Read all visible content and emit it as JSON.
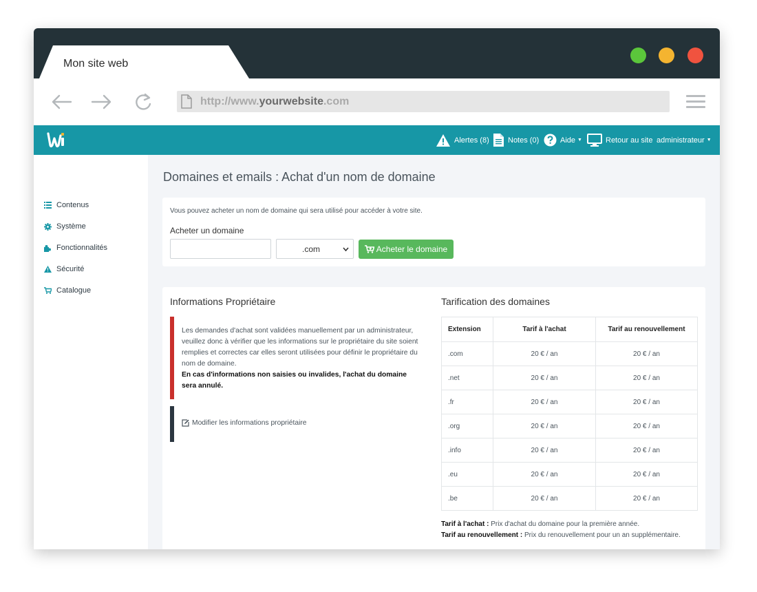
{
  "browser": {
    "tab_title": "Mon site web",
    "url_prefix": "http://www.",
    "url_domain": "yourwebsite",
    "url_suffix": ".com"
  },
  "navbar": {
    "alerts": "Alertes (8)",
    "notes": "Notes (0)",
    "help": "Aide",
    "back_to_site": "Retour au site",
    "user": "administrateur"
  },
  "sidebar": {
    "items": [
      {
        "label": "Contenus",
        "icon": "list-icon"
      },
      {
        "label": "Système",
        "icon": "gear-icon"
      },
      {
        "label": "Fonctionnalités",
        "icon": "puzzle-icon"
      },
      {
        "label": "Sécurité",
        "icon": "warning-icon"
      },
      {
        "label": "Catalogue",
        "icon": "cart-icon"
      }
    ]
  },
  "page": {
    "title": "Domaines et emails : Achat d'un nom de domaine"
  },
  "purchase": {
    "intro": "Vous pouvez acheter un nom de domaine qui sera utilisé pour accéder à votre site.",
    "label": "Acheter un domaine",
    "input_value": "",
    "extension_selected": ".com",
    "button": "Acheter le domaine"
  },
  "owner": {
    "title": "Informations Propriétaire",
    "notice": "Les demandes d'achat sont validées manuellement par un administrateur, veuillez donc à vérifier que les informations sur le propriétaire du site soient remplies et correctes car elles seront utilisées pour définir le propriétaire du nom de domaine.",
    "warning": "En cas d'informations non saisies ou invalides, l'achat du domaine sera annulé.",
    "edit_link": "Modifier les informations propriétaire"
  },
  "pricing": {
    "title": "Tarification des domaines",
    "headers": [
      "Extension",
      "Tarif à l'achat",
      "Tarif au renouvellement"
    ],
    "rows": [
      [
        ".com",
        "20 € / an",
        "20 € / an"
      ],
      [
        ".net",
        "20 € / an",
        "20 € / an"
      ],
      [
        ".fr",
        "20 € / an",
        "20 € / an"
      ],
      [
        ".org",
        "20 € / an",
        "20 € / an"
      ],
      [
        ".info",
        "20 € / an",
        "20 € / an"
      ],
      [
        ".eu",
        "20 € / an",
        "20 € / an"
      ],
      [
        ".be",
        "20 € / an",
        "20 € / an"
      ]
    ],
    "legend_purchase_label": "Tarif à l'achat :",
    "legend_purchase_text": " Prix d'achat du domaine pour la première année.",
    "legend_renewal_label": "Tarif au renouvellement :",
    "legend_renewal_text": " Prix du renouvellement pour un an supplémentaire."
  },
  "colors": {
    "navbar": "#1797a6",
    "titlebar": "#243238",
    "buy_button": "#58b85c",
    "alert_red": "#c9302c",
    "alert_dark": "#2b3640"
  }
}
